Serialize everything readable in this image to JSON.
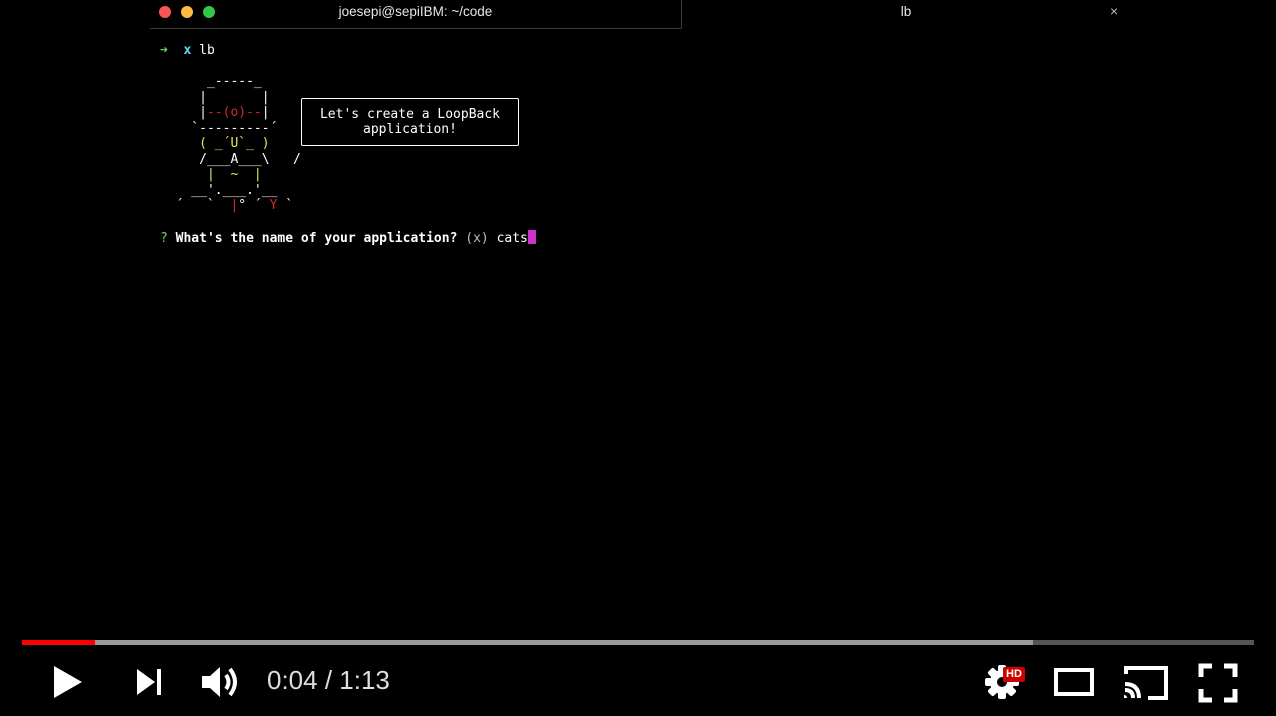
{
  "window": {
    "title": "joesepi@sepiIBM: ~/code",
    "tab_title": "lb",
    "tab_close": "×"
  },
  "terminal": {
    "prompt_arrow": "➜",
    "prompt_x": "x",
    "command": "lb",
    "speech_bubble": [
      "Let's create a LoopBack",
      "application!"
    ],
    "question_mark": "?",
    "question": "What's the name of your application?",
    "default_hint": "(x)",
    "answer": "cats"
  },
  "player": {
    "current_time": "0:04",
    "separator": " / ",
    "duration": "1:13",
    "played_fraction": 0.059,
    "buffered_fraction": 0.821,
    "hd_badge": "HD",
    "icons": [
      "play-icon",
      "next-icon",
      "volume-icon",
      "settings-icon",
      "theater-mode-icon",
      "cast-icon",
      "fullscreen-icon"
    ],
    "colors": {
      "progress_played": "#ff0000",
      "hd_badge": "#cc0000"
    }
  }
}
